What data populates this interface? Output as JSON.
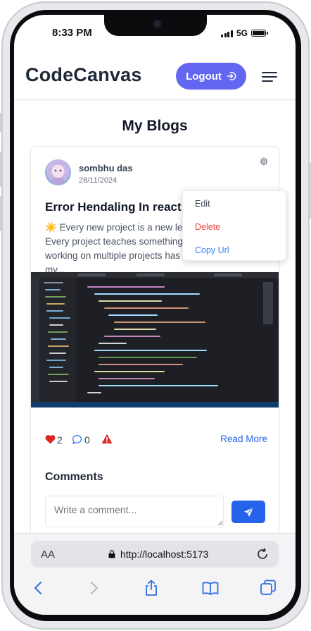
{
  "status_bar": {
    "time": "8:33 PM",
    "network": "5G",
    "battery_level": 1.0
  },
  "header": {
    "brand": "CodeCanvas",
    "logout_label": "Logout"
  },
  "page": {
    "title": "My Blogs"
  },
  "post": {
    "author": "sombhu das",
    "date": "28/11/2024",
    "title": "Error Hendaling In react",
    "excerpt_icon": "☀️",
    "excerpt": "Every new project is a new learning experience. Every project teaches something invaluable and working on multiple projects has significantly boosted my...",
    "likes": "2",
    "comments": "0",
    "read_more": "Read More",
    "image_icon": "code-editor-screenshot"
  },
  "dropdown": {
    "edit": "Edit",
    "delete": "Delete",
    "copy_url": "Copy Url"
  },
  "comments": {
    "title": "Comments",
    "placeholder": "Write a comment..."
  },
  "browser": {
    "aa_label": "AA",
    "url": "http://localhost:5173"
  },
  "colors": {
    "brand_text": "#1f2937",
    "logout_bg": "#6366f1",
    "delete_red": "#ef4444",
    "link_blue": "#2563eb",
    "like_red": "#dc2626"
  }
}
